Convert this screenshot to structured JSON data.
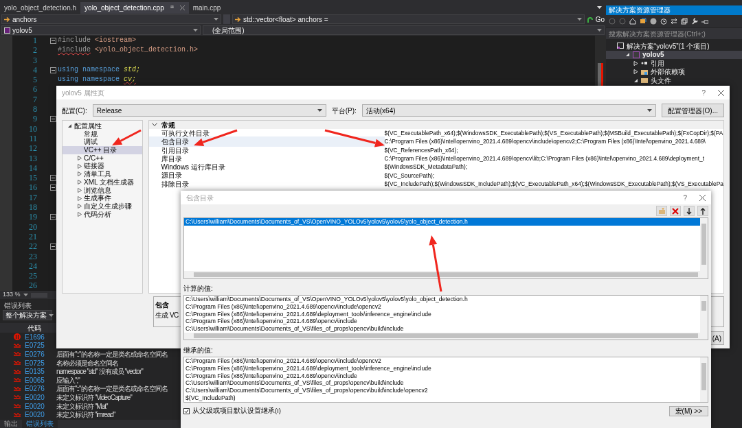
{
  "editor": {
    "file_tabs": [
      {
        "label": "yolo_object_detection.h",
        "selected": false
      },
      {
        "label": "yolo_object_detection.cpp",
        "selected": true
      },
      {
        "label": "main.cpp",
        "selected": false
      }
    ],
    "member_dropdown": "anchors",
    "definition_dropdown": "std::vector<float> anchors =",
    "go_button": "Go",
    "project_dropdown": "yolov5",
    "scope_dropdown": "(全局范围)",
    "lines": [
      {
        "number": "1",
        "fold": true,
        "tokens": [
          {
            "text": "#include",
            "kind": "directive",
            "error": false
          },
          {
            "text": "<iostream>",
            "kind": "string",
            "error": false
          }
        ]
      },
      {
        "number": "2",
        "fold": false,
        "tokens": [
          {
            "text": "#include",
            "kind": "directive",
            "error": true
          },
          {
            "text": "<yolo_object_detection.h>",
            "kind": "string",
            "error": false
          }
        ]
      },
      {
        "number": "3",
        "fold": false
      },
      {
        "number": "4",
        "fold": true,
        "tokens": [
          {
            "text": "using",
            "kind": "keyword",
            "error": false
          },
          {
            "text": "namespace",
            "kind": "keyword",
            "error": false
          },
          {
            "text": "std;",
            "kind": "namespace",
            "error": false
          }
        ]
      },
      {
        "number": "5",
        "fold": false,
        "tokens": [
          {
            "text": "using",
            "kind": "keyword",
            "error": false
          },
          {
            "text": "namespace",
            "kind": "keyword",
            "error": false
          },
          {
            "text": "cv;",
            "kind": "namespace",
            "error": true
          }
        ]
      },
      {
        "number": "6",
        "fold": false
      },
      {
        "number": "7",
        "fold": false
      },
      {
        "number": "8",
        "fold": false
      },
      {
        "number": "9",
        "fold": true
      },
      {
        "number": "10",
        "fold": false
      },
      {
        "number": "11",
        "fold": false
      },
      {
        "number": "12",
        "fold": false
      },
      {
        "number": "13",
        "fold": false
      },
      {
        "number": "14",
        "fold": false
      },
      {
        "number": "15",
        "fold": true
      },
      {
        "number": "16",
        "fold": true
      },
      {
        "number": "17",
        "fold": false
      },
      {
        "number": "18",
        "fold": false
      },
      {
        "number": "19",
        "fold": true
      },
      {
        "number": "20",
        "fold": false
      },
      {
        "number": "21",
        "fold": false
      },
      {
        "number": "22",
        "fold": true
      },
      {
        "number": "23",
        "fold": false
      },
      {
        "number": "24",
        "fold": false
      },
      {
        "number": "25",
        "fold": false
      },
      {
        "number": "26",
        "fold": false
      }
    ],
    "zoom": "133 %"
  },
  "solution_explorer": {
    "title": "解决方案资源管理器",
    "search": {
      "placeholder": "搜索解决方案资源管理器(Ctrl+;)"
    },
    "tree": [
      {
        "label": "解决方案“yolov5”(1 个项目)",
        "kind": "solution",
        "selected": false,
        "children": [
          {
            "label": "yolov5",
            "kind": "project",
            "selected": true,
            "expanded": true,
            "children": [
              {
                "label": "引用",
                "kind": "references",
                "selected": false,
                "expanded": false
              },
              {
                "label": "外部依赖项",
                "kind": "dependencies",
                "selected": false,
                "expanded": false
              },
              {
                "label": "头文件",
                "kind": "folder",
                "selected": false,
                "expanded": true
              }
            ]
          }
        ]
      }
    ]
  },
  "error_list": {
    "title": "错误列表",
    "scope": "整个解决方案",
    "column": "代码",
    "rows": [
      {
        "kind": "error",
        "code": "E1696"
      },
      {
        "kind": "squiggle",
        "code": "E0725"
      },
      {
        "kind": "squiggle",
        "code": "E0276",
        "message": "后面有\"::\"的名称一定是类名或命名空间名"
      },
      {
        "kind": "squiggle",
        "code": "E0725",
        "message": "名称必须是命名空间名"
      },
      {
        "kind": "squiggle",
        "code": "E0135",
        "message": "namespace \"std\" 没有成员 \"vector\""
      },
      {
        "kind": "squiggle",
        "code": "E0065",
        "message": "应输入\";\""
      },
      {
        "kind": "squiggle",
        "code": "E0276",
        "message": "后面有\"::\"的名称一定是类名或命名空间名"
      },
      {
        "kind": "squiggle",
        "code": "E0020",
        "message": "未定义标识符 \"VideoCapture\""
      },
      {
        "kind": "squiggle",
        "code": "E0020",
        "message": "未定义标识符 \"Mat\""
      },
      {
        "kind": "squiggle",
        "code": "E0020",
        "message": "未定义标识符 \"imread\""
      }
    ],
    "bottom_tabs": [
      {
        "label": "输出",
        "selected": false
      },
      {
        "label": "错误列表",
        "selected": true
      }
    ]
  },
  "property_dialog": {
    "title": "yolov5 属性页",
    "help": "?",
    "config_label": "配置(C):",
    "config": "Release",
    "platform_label": "平台(P):",
    "platform": "活动(x64)",
    "manager_button": "配置管理器(O)...",
    "tree": [
      {
        "label": "配置属性",
        "expanded": true,
        "selected": false,
        "children": [
          {
            "label": "常规",
            "selected": false
          },
          {
            "label": "调试",
            "selected": false
          },
          {
            "label": "VC++ 目录",
            "selected": true
          },
          {
            "label": "C/C++",
            "selected": false,
            "expanded": false
          },
          {
            "label": "链接器",
            "selected": false,
            "expanded": false
          },
          {
            "label": "清单工具",
            "selected": false,
            "expanded": false
          },
          {
            "label": "XML 文档生成器",
            "selected": false,
            "expanded": false
          },
          {
            "label": "浏览信息",
            "selected": false,
            "expanded": false
          },
          {
            "label": "生成事件",
            "selected": false,
            "expanded": false
          },
          {
            "label": "自定义生成步骤",
            "selected": false,
            "expanded": false
          },
          {
            "label": "代码分析",
            "selected": false,
            "expanded": false
          }
        ]
      }
    ],
    "category": {
      "label": "常规",
      "expanded": true
    },
    "properties": [
      {
        "name": "可执行文件目录",
        "value": "$(VC_ExecutablePath_x64);$(WindowsSDK_ExecutablePath);$(VS_ExecutablePath);$(MSBuild_ExecutablePath);$(FxCopDir);$(PA",
        "selected": false
      },
      {
        "name": "包含目录",
        "value": "C:\\Program Files (x86)\\Intel\\openvino_2021.4.689\\opencv\\include\\opencv2;C:\\Program Files (x86)\\Intel\\openvino_2021.4.689\\",
        "selected": true
      },
      {
        "name": "引用目录",
        "value": "$(VC_ReferencesPath_x64);",
        "selected": false
      },
      {
        "name": "库目录",
        "value": "C:\\Program Files (x86)\\Intel\\openvino_2021.4.689\\opencv\\lib;C:\\Program Files (x86)\\Intel\\openvino_2021.4.689\\deployment_t",
        "selected": false
      },
      {
        "name": "Windows 运行库目录",
        "value": "$(WindowsSDK_MetadataPath);",
        "selected": false
      },
      {
        "name": "源目录",
        "value": "$(VC_SourcePath);",
        "selected": false
      },
      {
        "name": "排除目录",
        "value": "$(VC_IncludePath);$(WindowsSDK_IncludePath);$(VC_ExecutablePath_x64);$(WindowsSDK_ExecutablePath);$(VS_ExecutablePa",
        "selected": false
      }
    ],
    "description_title": "包含",
    "description": "生成 VC",
    "apply_button": "(A)"
  },
  "include_dialog": {
    "title": "包含目录",
    "help": "?",
    "entries": [
      {
        "text": "C:\\Users\\william\\Documents\\Documents_of_VS\\OpenVINO_YOLOv5\\yolov5\\yolov5\\yolo_object_detection.h",
        "selected": true
      }
    ],
    "computed_label": "计算的值:",
    "computed": [
      "C:\\Users\\william\\Documents\\Documents_of_VS\\OpenVINO_YOLOv5\\yolov5\\yolov5\\yolo_object_detection.h",
      "C:\\Program Files (x86)\\Intel\\openvino_2021.4.689\\opencv\\include\\opencv2",
      "C:\\Program Files (x86)\\Intel\\openvino_2021.4.689\\deployment_tools\\inference_engine\\include",
      "C:\\Program Files (x86)\\Intel\\openvino_2021.4.689\\opencv\\include",
      "C:\\Users\\william\\Documents\\Documents_of_VS\\files_of_props\\opencv\\build\\include"
    ],
    "inherited_label": "继承的值:",
    "inherited": [
      "C:\\Program Files (x86)\\Intel\\openvino_2021.4.689\\opencv\\include\\opencv2",
      "C:\\Program Files (x86)\\Intel\\openvino_2021.4.689\\deployment_tools\\inference_engine\\include",
      "C:\\Program Files (x86)\\Intel\\openvino_2021.4.689\\opencv\\include",
      "C:\\Users\\william\\Documents\\Documents_of_VS\\files_of_props\\opencv\\build\\include",
      "C:\\Users\\william\\Documents\\Documents_of_VS\\files_of_props\\opencv\\build\\include\\opencv2",
      "$(VC_IncludePath)"
    ],
    "inherit_checkbox": {
      "label": "从父级或项目默认设置继承(I)",
      "checked": true
    },
    "macro_button": "宏(M) >>"
  }
}
